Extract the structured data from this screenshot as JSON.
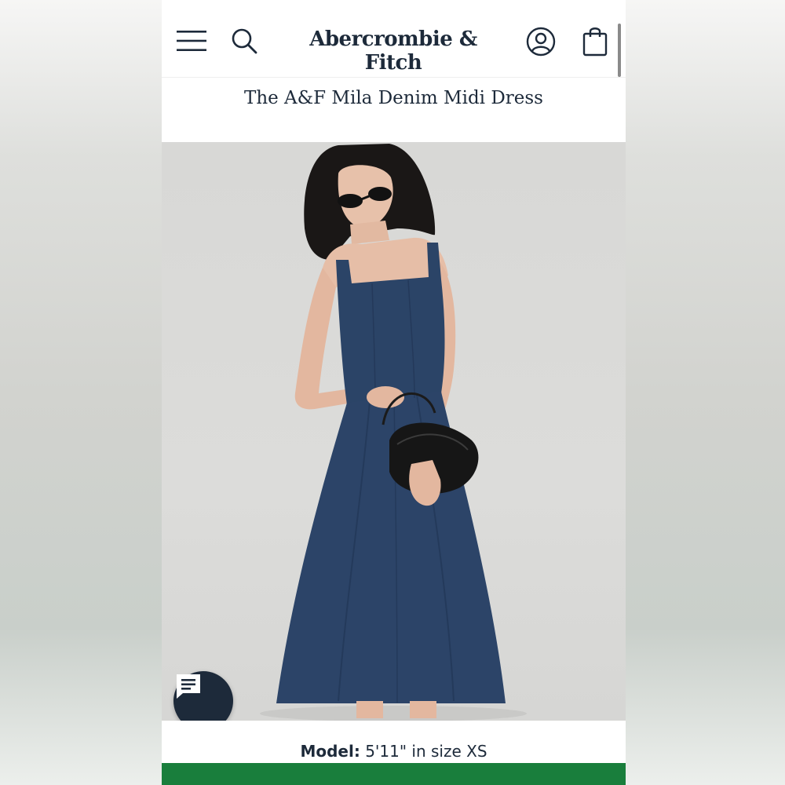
{
  "header": {
    "brand": "Abercrombie & Fitch",
    "icons": [
      "menu-icon",
      "search-icon",
      "account-icon",
      "shopping-bag-icon"
    ]
  },
  "product": {
    "title": "The A&F Mila Denim Midi Dress"
  },
  "model_info": {
    "label": "Model:",
    "value": "5'11\" in size XS"
  },
  "chat": {
    "icon": "chat-bubble-icon"
  },
  "colors": {
    "navy": "#1d2a3a",
    "cta_green": "#197e3c",
    "denim": "#2c4468"
  }
}
